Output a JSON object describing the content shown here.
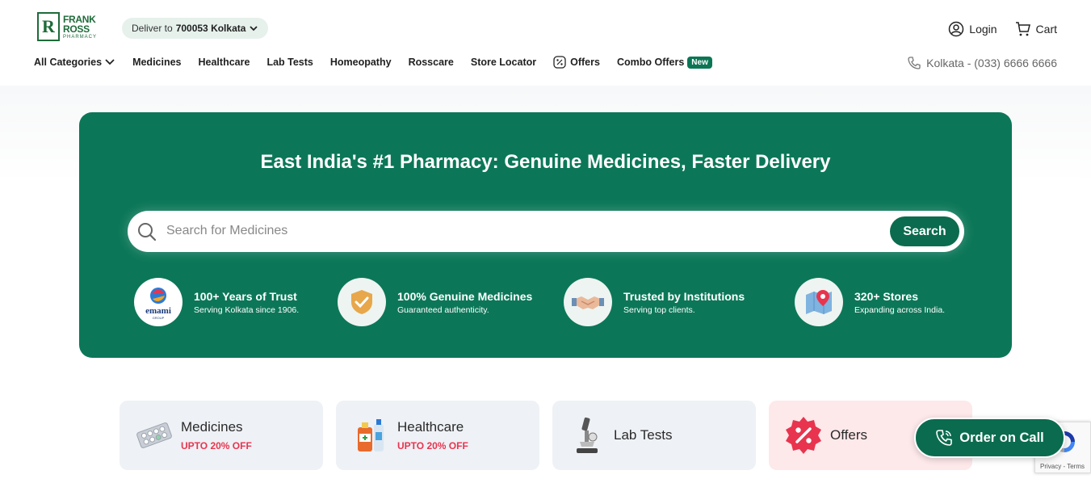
{
  "brand": {
    "logo_line1": "FRANK",
    "logo_line2": "ROSS",
    "logo_line3": "PHARMACY",
    "logo_letter": "R"
  },
  "deliver": {
    "prefix": "Deliver to",
    "location": "700053 Kolkata"
  },
  "header_actions": {
    "login": "Login",
    "cart": "Cart"
  },
  "nav": {
    "all_categories": "All Categories",
    "items": [
      "Medicines",
      "Healthcare",
      "Lab Tests",
      "Homeopathy",
      "Rosscare",
      "Store Locator"
    ],
    "offers": "Offers",
    "combo_offers": "Combo Offers",
    "new_badge": "New"
  },
  "contact": {
    "phone": "Kolkata - (033) 6666 6666"
  },
  "hero": {
    "title": "East India's #1 Pharmacy: Genuine Medicines, Faster Delivery",
    "search_placeholder": "Search for Medicines",
    "search_button": "Search",
    "trust": [
      {
        "title": "100+ Years of Trust",
        "desc": "Serving Kolkata since 1906.",
        "icon": "emami-group-logo"
      },
      {
        "title": "100% Genuine Medicines",
        "desc": "Guaranteed authenticity.",
        "icon": "shield-check-icon"
      },
      {
        "title": "Trusted by Institutions",
        "desc": "Serving top clients.",
        "icon": "handshake-icon"
      },
      {
        "title": "320+ Stores",
        "desc": "Expanding across India.",
        "icon": "map-pin-icon"
      }
    ]
  },
  "categories": [
    {
      "name": "Medicines",
      "discount": "UPTO 20% OFF",
      "icon": "pills-icon"
    },
    {
      "name": "Healthcare",
      "discount": "UPTO 20% OFF",
      "icon": "healthcare-bottles-icon"
    },
    {
      "name": "Lab Tests",
      "discount": "",
      "icon": "microscope-icon"
    },
    {
      "name": "Offers",
      "discount": "",
      "icon": "percent-badge-icon"
    }
  ],
  "order_on_call": "Order on Call",
  "recaptcha": {
    "privacy": "Privacy",
    "terms": "Terms",
    "separator": " - "
  },
  "colors": {
    "brand_green": "#0c7758",
    "button_green": "#0b6b4e",
    "discount_red": "#e8344e",
    "offers_card_bg": "#fde8ea"
  }
}
